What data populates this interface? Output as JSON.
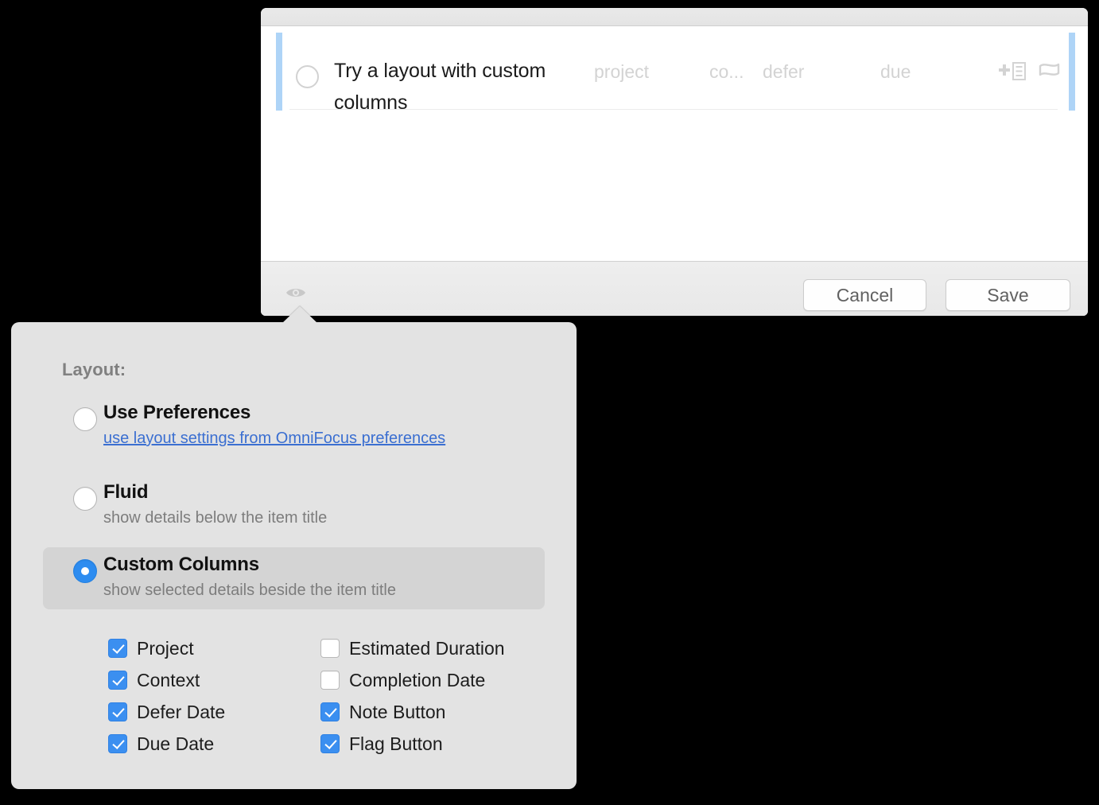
{
  "window": {
    "title": "",
    "task_row": {
      "checkbox_state": "unchecked",
      "title": "Try a layout with custom columns",
      "columns": [
        {
          "key": "project",
          "placeholder": "project"
        },
        {
          "key": "context",
          "placeholder": "co..."
        },
        {
          "key": "defer",
          "placeholder": "defer"
        },
        {
          "key": "due",
          "placeholder": "due"
        }
      ],
      "note_icon": "add-note-icon",
      "flag_icon": "flag-icon"
    },
    "bottom_bar": {
      "view_options_icon": "eye-icon",
      "cancel_label": "Cancel",
      "save_label": "Save"
    }
  },
  "popover": {
    "section_label": "Layout:",
    "options": [
      {
        "id": "use-preferences",
        "title": "Use Preferences",
        "subtitle": "use layout settings from OmniFocus preferences",
        "subtitle_is_link": true,
        "selected": false
      },
      {
        "id": "fluid",
        "title": "Fluid",
        "subtitle": "show details below the item title",
        "subtitle_is_link": false,
        "selected": false
      },
      {
        "id": "custom-columns",
        "title": "Custom Columns",
        "subtitle": "show selected details beside the item title",
        "subtitle_is_link": false,
        "selected": true
      }
    ],
    "column_checkboxes": {
      "left": [
        {
          "label": "Project",
          "checked": true
        },
        {
          "label": "Context",
          "checked": true
        },
        {
          "label": "Defer Date",
          "checked": true
        },
        {
          "label": "Due Date",
          "checked": true
        }
      ],
      "right": [
        {
          "label": "Estimated Duration",
          "checked": false
        },
        {
          "label": "Completion Date",
          "checked": false
        },
        {
          "label": "Note Button",
          "checked": true
        },
        {
          "label": "Flag Button",
          "checked": true
        }
      ]
    }
  },
  "colors": {
    "accent_blue": "#2d8cf0",
    "checkbox_blue": "#3b8ff0",
    "selection_bar": "#aed4f7",
    "link_blue": "#3b6fd1",
    "popover_bg": "#e3e3e3",
    "selected_row_bg": "#d4d4d4",
    "placeholder_gray": "#d3d3d3"
  }
}
